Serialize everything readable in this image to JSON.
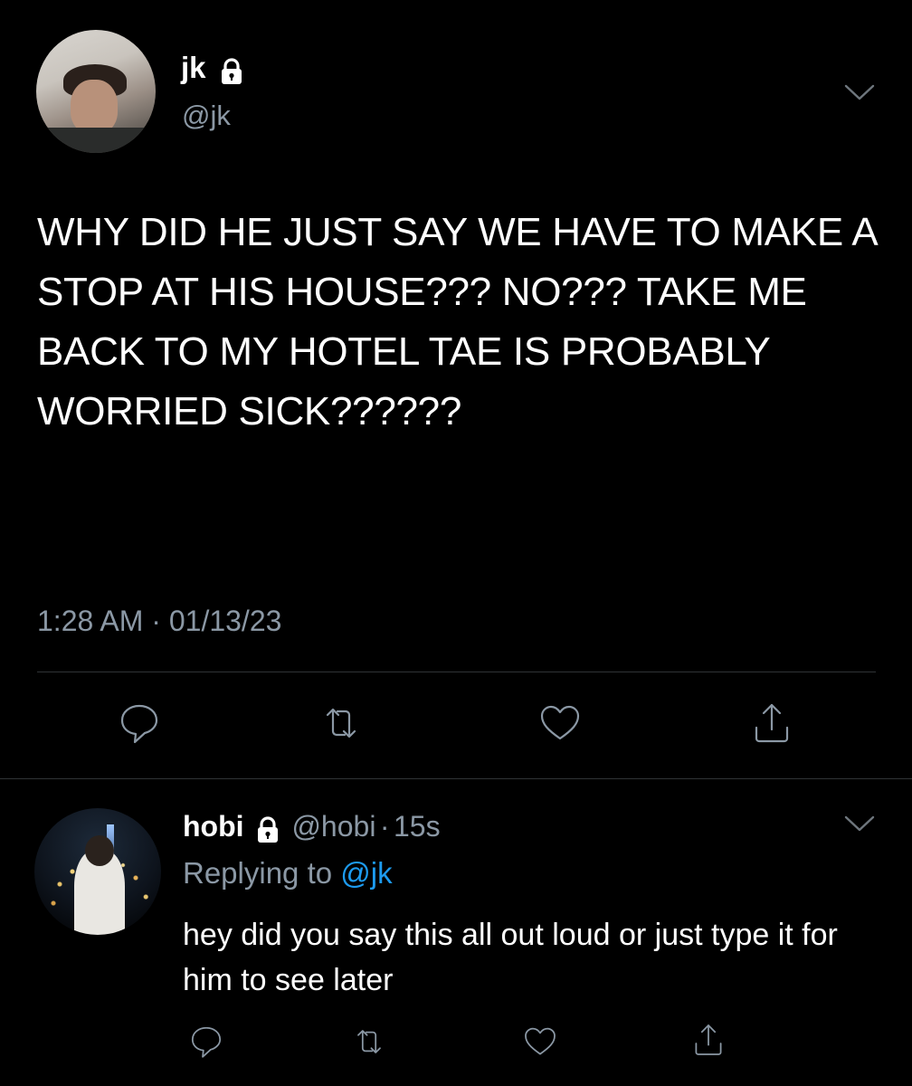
{
  "main_tweet": {
    "author_name": "jk",
    "author_handle": "@jk",
    "text": "WHY DID HE JUST SAY WE HAVE TO MAKE A STOP AT HIS HOUSE??? NO??? TAKE ME BACK TO MY HOTEL TAE IS PROBABLY WORRIED SICK??????",
    "timestamp": "1:28 AM · 01/13/23",
    "icons": {
      "lock": "lock-icon",
      "menu": "chevron-down-icon",
      "reply": "reply-icon",
      "retweet": "retweet-icon",
      "like": "heart-icon",
      "share": "share-icon"
    }
  },
  "reply_tweet": {
    "author_name": "hobi",
    "author_handle": "@hobi",
    "separator": "·",
    "time_ago": "15s",
    "replying_to_label": "Replying to",
    "replying_to_handle": "@jk",
    "text": "hey did you say this all out loud or just type it for him to see later"
  },
  "colors": {
    "background": "#000000",
    "text_primary": "#ffffff",
    "text_secondary": "#8b98a5",
    "accent": "#1d9bf0",
    "divider": "#2f3336"
  }
}
